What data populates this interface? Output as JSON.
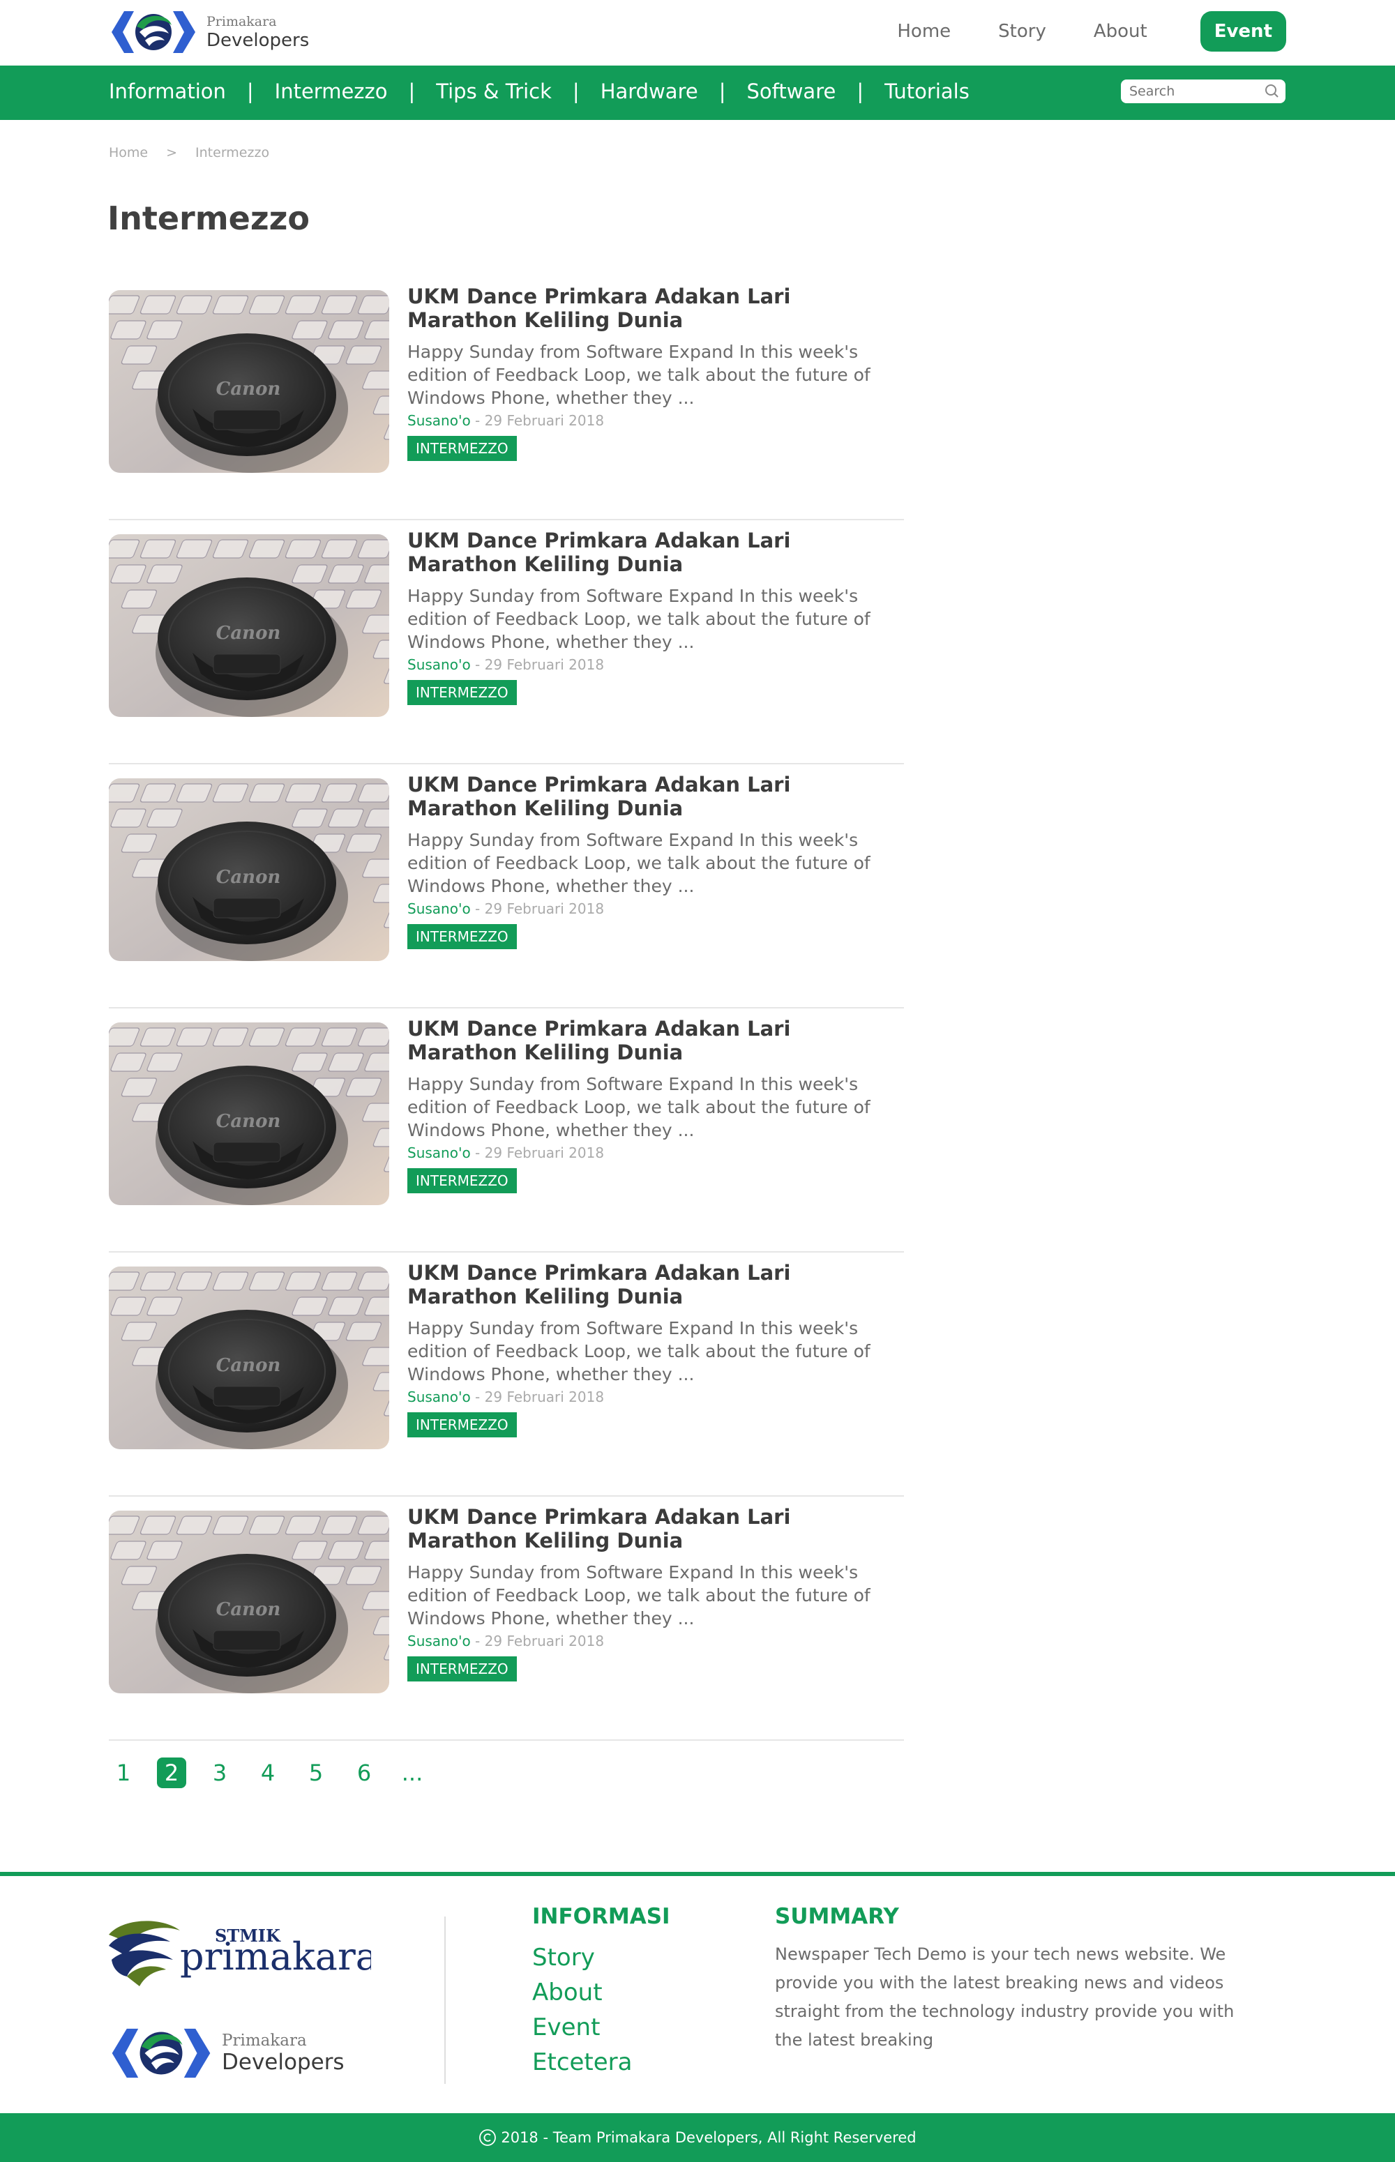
{
  "brand": {
    "line1": "Primakara",
    "line2": "Developers"
  },
  "topnav": {
    "home": "Home",
    "story": "Story",
    "about": "About",
    "event": "Event"
  },
  "categories": [
    "Information",
    "Intermezzo",
    "Tips & Trick",
    "Hardware",
    "Software",
    "Tutorials"
  ],
  "category_separator": "|",
  "search": {
    "placeholder": "Search"
  },
  "breadcrumb": {
    "home": "Home",
    "separator": ">",
    "current": "Intermezzo"
  },
  "page_title": "Intermezzo",
  "articles": [
    {
      "title": "UKM Dance Primkara Adakan Lari Marathon Keliling Dunia",
      "excerpt": "Happy Sunday from Software Expand In this week's edition of Feedback Loop, we talk about the future of Windows Phone, whether they ...",
      "author": "Susano'o",
      "date": " - 29 Februari 2018",
      "tag": "INTERMEZZO",
      "image_text": "Canon"
    },
    {
      "title": "UKM Dance Primkara Adakan Lari Marathon Keliling Dunia",
      "excerpt": "Happy Sunday from Software Expand In this week's edition of Feedback Loop, we talk about the future of Windows Phone, whether they ...",
      "author": "Susano'o",
      "date": " - 29 Februari 2018",
      "tag": "INTERMEZZO",
      "image_text": "Canon"
    },
    {
      "title": "UKM Dance Primkara Adakan Lari Marathon Keliling Dunia",
      "excerpt": "Happy Sunday from Software Expand In this week's edition of Feedback Loop, we talk about the future of Windows Phone, whether they ...",
      "author": "Susano'o",
      "date": " - 29 Februari 2018",
      "tag": "INTERMEZZO",
      "image_text": "Canon"
    },
    {
      "title": "UKM Dance Primkara Adakan Lari Marathon Keliling Dunia",
      "excerpt": "Happy Sunday from Software Expand In this week's edition of Feedback Loop, we talk about the future of Windows Phone, whether they ...",
      "author": "Susano'o",
      "date": " - 29 Februari 2018",
      "tag": "INTERMEZZO",
      "image_text": "Canon"
    },
    {
      "title": "UKM Dance Primkara Adakan Lari Marathon Keliling Dunia",
      "excerpt": "Happy Sunday from Software Expand In this week's edition of Feedback Loop, we talk about the future of Windows Phone, whether they ...",
      "author": "Susano'o",
      "date": " - 29 Februari 2018",
      "tag": "INTERMEZZO",
      "image_text": "Canon"
    },
    {
      "title": "UKM Dance Primkara Adakan Lari Marathon Keliling Dunia",
      "excerpt": "Happy Sunday from Software Expand In this week's edition of Feedback Loop, we talk about the future of Windows Phone, whether they ...",
      "author": "Susano'o",
      "date": " - 29 Februari 2018",
      "tag": "INTERMEZZO",
      "image_text": "Canon"
    }
  ],
  "pagination": {
    "pages": [
      "1",
      "2",
      "3",
      "4",
      "5",
      "6",
      "..."
    ],
    "current": "2"
  },
  "footer": {
    "logo_stmik": {
      "small": "STMIK",
      "large": "primakara"
    },
    "informasi_title": "INFORMASI",
    "informasi_links": [
      "Story",
      "About",
      "Event",
      "Etcetera"
    ],
    "summary_title": "SUMMARY",
    "summary_text": "Newspaper Tech Demo is your tech news website. We provide you with the latest breaking news and videos straight from the technology industry provide you with the latest breaking",
    "copyright": "2018 -  Team Primakara Developers, All Right Reservered"
  },
  "colors": {
    "accent": "#129c58",
    "logo_blue": "#2f5fd0",
    "logo_green": "#1f9c4a",
    "logo_navy": "#1b2f6b"
  },
  "icons": {
    "search": "search-icon",
    "copyright": "copyright-icon",
    "chevron": "chevron-right-icon"
  }
}
